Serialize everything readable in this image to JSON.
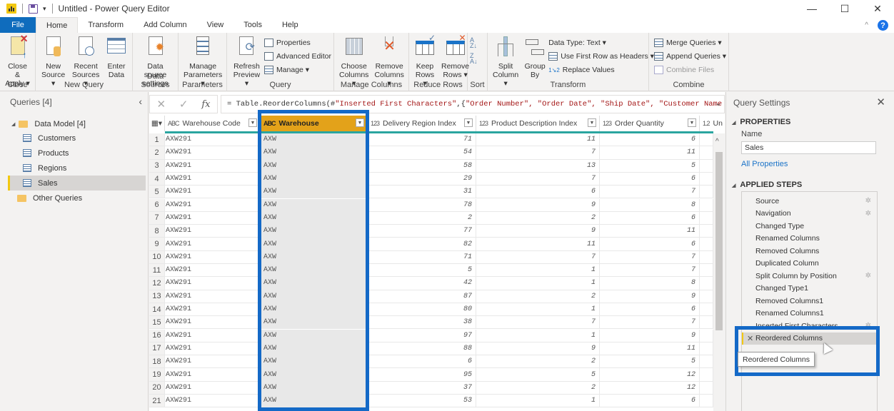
{
  "window": {
    "title": "Untitled - Power Query Editor",
    "controls": {
      "minimize": "—",
      "maximize": "☐",
      "close": "✕"
    }
  },
  "tabs": [
    "File",
    "Home",
    "Transform",
    "Add Column",
    "View",
    "Tools",
    "Help"
  ],
  "active_tab": "Home",
  "ribbon": {
    "groups": [
      {
        "label": "Close",
        "buttons": [
          "Close & Apply ▾"
        ]
      },
      {
        "label": "New Query",
        "buttons": [
          "New Source ▾",
          "Recent Sources ▾",
          "Enter Data"
        ]
      },
      {
        "label": "Data Sources",
        "buttons": [
          "Data source settings"
        ]
      },
      {
        "label": "Parameters",
        "buttons": [
          "Manage Parameters ▾"
        ]
      },
      {
        "label": "Query",
        "buttons": [
          "Refresh Preview ▾"
        ],
        "small": [
          "Properties",
          "Advanced Editor",
          "Manage ▾"
        ]
      },
      {
        "label": "Manage Columns",
        "buttons": [
          "Choose Columns ▾",
          "Remove Columns ▾"
        ]
      },
      {
        "label": "Reduce Rows",
        "buttons": [
          "Keep Rows ▾",
          "Remove Rows ▾"
        ]
      },
      {
        "label": "Sort",
        "buttons": [
          "A→Z",
          "Z→A"
        ]
      },
      {
        "label": "Transform",
        "buttons": [
          "Split Column ▾",
          "Group By"
        ],
        "small": [
          "Data Type: Text ▾",
          "Use First Row as Headers ▾",
          "Replace Values"
        ]
      },
      {
        "label": "Combine",
        "small": [
          "Merge Queries ▾",
          "Append Queries ▾",
          "Combine Files"
        ]
      }
    ],
    "labels": {
      "close_apply_1": "Close &",
      "close_apply_2": "Apply ▾",
      "new_source_1": "New",
      "new_source_2": "Source ▾",
      "recent_1": "Recent",
      "recent_2": "Sources ▾",
      "enter_1": "Enter",
      "enter_2": "Data",
      "dss_1": "Data source",
      "dss_2": "settings",
      "mp_1": "Manage",
      "mp_2": "Parameters ▾",
      "refresh_1": "Refresh",
      "refresh_2": "Preview ▾",
      "properties": "Properties",
      "advanced_editor": "Advanced Editor",
      "manage": "Manage ▾",
      "choose_1": "Choose",
      "choose_2": "Columns ▾",
      "remcol_1": "Remove",
      "remcol_2": "Columns ▾",
      "keep_1": "Keep",
      "keep_2": "Rows ▾",
      "remrow_1": "Remove",
      "remrow_2": "Rows ▾",
      "split_1": "Split",
      "split_2": "Column ▾",
      "group_1": "Group",
      "group_2": "By",
      "data_type": "Data Type: Text ▾",
      "first_row": "Use First Row as Headers ▾",
      "replace": "Replace Values",
      "merge": "Merge Queries ▾",
      "append": "Append Queries ▾",
      "combine": "Combine Files"
    }
  },
  "queries_pane": {
    "title": "Queries [4]",
    "folder": "Data Model [4]",
    "items": [
      "Customers",
      "Products",
      "Regions",
      "Sales"
    ],
    "selected": "Sales",
    "other": "Other Queries"
  },
  "formula_bar": {
    "prefix": "= Table.ReorderColumns(#",
    "arg1": "\"Inserted First Characters\"",
    "mid": ",{",
    "cols": "\"Order Number\", \"Order Date\", \"Ship Date\", \"Customer Name"
  },
  "table": {
    "columns": [
      {
        "type": "ABC",
        "name": "Warehouse Code"
      },
      {
        "type": "ABC",
        "name": "Warehouse",
        "selected": true
      },
      {
        "type": "123",
        "name": "Delivery Region Index"
      },
      {
        "type": "123",
        "name": "Product Description Index"
      },
      {
        "type": "123",
        "name": "Order Quantity"
      },
      {
        "type": "1.2",
        "name": "Un"
      }
    ],
    "rows": [
      [
        "AXW291",
        "AXW",
        71,
        11,
        6
      ],
      [
        "AXW291",
        "AXW",
        54,
        7,
        11
      ],
      [
        "AXW291",
        "AXW",
        58,
        13,
        5
      ],
      [
        "AXW291",
        "AXW",
        29,
        7,
        6
      ],
      [
        "AXW291",
        "AXW",
        31,
        6,
        7
      ],
      [
        "AXW291",
        "AXW",
        78,
        9,
        8
      ],
      [
        "AXW291",
        "AXW",
        2,
        2,
        6
      ],
      [
        "AXW291",
        "AXW",
        77,
        9,
        11
      ],
      [
        "AXW291",
        "AXW",
        82,
        11,
        6
      ],
      [
        "AXW291",
        "AXW",
        71,
        7,
        7
      ],
      [
        "AXW291",
        "AXW",
        5,
        1,
        7
      ],
      [
        "AXW291",
        "AXW",
        42,
        1,
        8
      ],
      [
        "AXW291",
        "AXW",
        87,
        2,
        9
      ],
      [
        "AXW291",
        "AXW",
        80,
        1,
        6
      ],
      [
        "AXW291",
        "AXW",
        38,
        7,
        7
      ],
      [
        "AXW291",
        "AXW",
        97,
        1,
        9
      ],
      [
        "AXW291",
        "AXW",
        88,
        9,
        11
      ],
      [
        "AXW291",
        "AXW",
        6,
        2,
        5
      ],
      [
        "AXW291",
        "AXW",
        95,
        5,
        12
      ],
      [
        "AXW291",
        "AXW",
        37,
        2,
        12
      ],
      [
        "AXW291",
        "AXW",
        53,
        1,
        6
      ]
    ]
  },
  "query_settings": {
    "title": "Query Settings",
    "properties_label": "PROPERTIES",
    "name_label": "Name",
    "name_value": "Sales",
    "all_properties": "All Properties",
    "applied_steps_label": "APPLIED STEPS",
    "steps": [
      {
        "name": "Source",
        "gear": true
      },
      {
        "name": "Navigation",
        "gear": true
      },
      {
        "name": "Changed Type",
        "gear": false
      },
      {
        "name": "Renamed Columns",
        "gear": false
      },
      {
        "name": "Removed Columns",
        "gear": false
      },
      {
        "name": "Duplicated Column",
        "gear": false
      },
      {
        "name": "Split Column by Position",
        "gear": true
      },
      {
        "name": "Changed Type1",
        "gear": false
      },
      {
        "name": "Removed Columns1",
        "gear": false
      },
      {
        "name": "Renamed Columns1",
        "gear": false
      },
      {
        "name": "Inserted First Characters",
        "gear": true
      },
      {
        "name": "Reordered Columns",
        "gear": false,
        "selected": true
      }
    ],
    "tooltip": "Reordered Columns"
  },
  "colors": {
    "accent": "#0f6cbd",
    "highlight_box": "#1469c7",
    "selected_header": "#e3a21a",
    "teal": "#2aa5a0"
  }
}
